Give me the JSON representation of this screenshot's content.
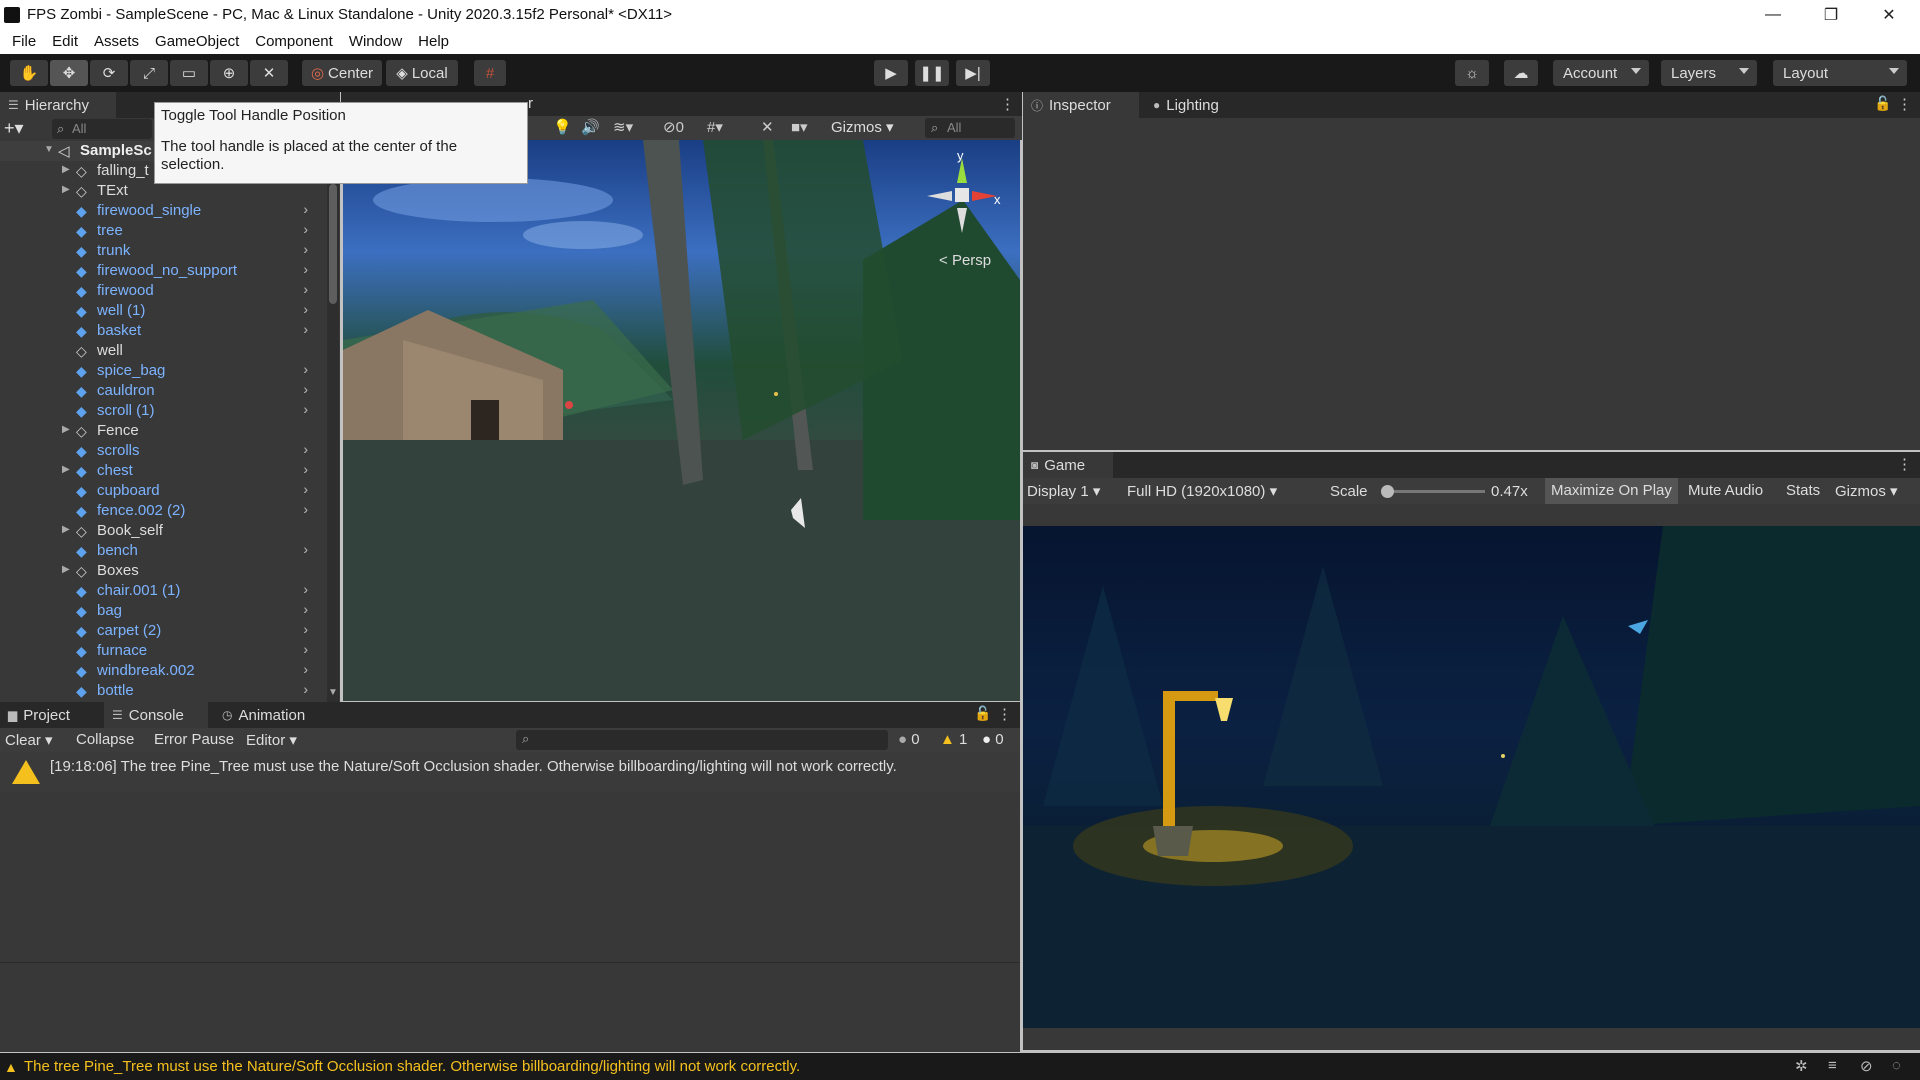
{
  "window": {
    "title": "FPS Zombi - SampleScene - PC, Mac & Linux Standalone - Unity 2020.3.15f2 Personal* <DX11>",
    "controls": [
      "—",
      "❐",
      "✕"
    ]
  },
  "menu": [
    "File",
    "Edit",
    "Assets",
    "GameObject",
    "Component",
    "Window",
    "Help"
  ],
  "toolbar": {
    "pivot_label": "Center",
    "space_label": "Local",
    "account_label": "Account",
    "layers_label": "Layers",
    "layout_label": "Layout"
  },
  "tooltip": {
    "title": "Toggle Tool Handle Position",
    "body": "The tool handle is placed at the center of the selection."
  },
  "hierarchy": {
    "tab_label": "Hierarchy",
    "search_placeholder": "All",
    "scene_name": "SampleSc",
    "items": [
      {
        "label": "falling_t",
        "type": "object",
        "expand": true,
        "chevron": false
      },
      {
        "label": "TExt",
        "type": "object",
        "expand": true,
        "chevron": false
      },
      {
        "label": "firewood_single",
        "type": "prefab",
        "expand": false,
        "chevron": true
      },
      {
        "label": "tree",
        "type": "prefab",
        "expand": false,
        "chevron": true
      },
      {
        "label": "trunk",
        "type": "prefab",
        "expand": false,
        "chevron": true
      },
      {
        "label": "firewood_no_support",
        "type": "prefab",
        "expand": false,
        "chevron": true
      },
      {
        "label": "firewood",
        "type": "prefab",
        "expand": false,
        "chevron": true
      },
      {
        "label": "well (1)",
        "type": "prefab",
        "expand": false,
        "chevron": true
      },
      {
        "label": "basket",
        "type": "prefab",
        "expand": false,
        "chevron": true
      },
      {
        "label": "well",
        "type": "object",
        "expand": false,
        "chevron": false
      },
      {
        "label": "spice_bag",
        "type": "prefab",
        "expand": false,
        "chevron": true
      },
      {
        "label": "cauldron",
        "type": "prefab",
        "expand": false,
        "chevron": true
      },
      {
        "label": "scroll (1)",
        "type": "prefab",
        "expand": false,
        "chevron": true
      },
      {
        "label": "Fence",
        "type": "object",
        "expand": true,
        "chevron": false
      },
      {
        "label": "scrolls",
        "type": "prefab",
        "expand": false,
        "chevron": true
      },
      {
        "label": "chest",
        "type": "prefab",
        "expand": true,
        "chevron": true
      },
      {
        "label": "cupboard",
        "type": "prefab",
        "expand": false,
        "chevron": true
      },
      {
        "label": "fence.002 (2)",
        "type": "prefab",
        "expand": false,
        "chevron": true
      },
      {
        "label": "Book_self",
        "type": "object",
        "expand": true,
        "chevron": false
      },
      {
        "label": "bench",
        "type": "prefab",
        "expand": false,
        "chevron": true
      },
      {
        "label": "Boxes",
        "type": "object",
        "expand": true,
        "chevron": false
      },
      {
        "label": "chair.001 (1)",
        "type": "prefab",
        "expand": false,
        "chevron": true
      },
      {
        "label": "bag",
        "type": "prefab",
        "expand": false,
        "chevron": true
      },
      {
        "label": "carpet (2)",
        "type": "prefab",
        "expand": false,
        "chevron": true
      },
      {
        "label": "furnace",
        "type": "prefab",
        "expand": false,
        "chevron": true
      },
      {
        "label": "windbreak.002",
        "type": "prefab",
        "expand": false,
        "chevron": true
      },
      {
        "label": "bottle",
        "type": "prefab",
        "expand": false,
        "chevron": true
      }
    ]
  },
  "scene": {
    "tab_partial": "r",
    "hidden_count": "0",
    "gizmos_label": "Gizmos",
    "search_placeholder": "All",
    "persp_label": "Persp",
    "axis_x": "x",
    "axis_y": "y"
  },
  "inspector": {
    "tabs": [
      "Inspector",
      "Lighting"
    ]
  },
  "game": {
    "tab_label": "Game",
    "display": "Display 1",
    "resolution": "Full HD (1920x1080)",
    "scale_label": "Scale",
    "scale_value": "0.47x",
    "scale_fraction": 0.0,
    "maximize_label": "Maximize On Play",
    "mute_label": "Mute Audio",
    "stats_label": "Stats",
    "gizmos_label": "Gizmos"
  },
  "bottom": {
    "tabs": [
      "Project",
      "Console",
      "Animation"
    ],
    "clear_label": "Clear",
    "collapse_label": "Collapse",
    "error_pause_label": "Error Pause",
    "editor_label": "Editor",
    "info_count": "0",
    "warn_count": "1",
    "error_count": "0",
    "messages": [
      "[19:18:06] The tree Pine_Tree must use the Nature/Soft Occlusion shader. Otherwise billboarding/lighting will not work correctly."
    ]
  },
  "status": {
    "message": "The tree Pine_Tree must use the Nature/Soft Occlusion shader. Otherwise billboarding/lighting will not work correctly."
  }
}
